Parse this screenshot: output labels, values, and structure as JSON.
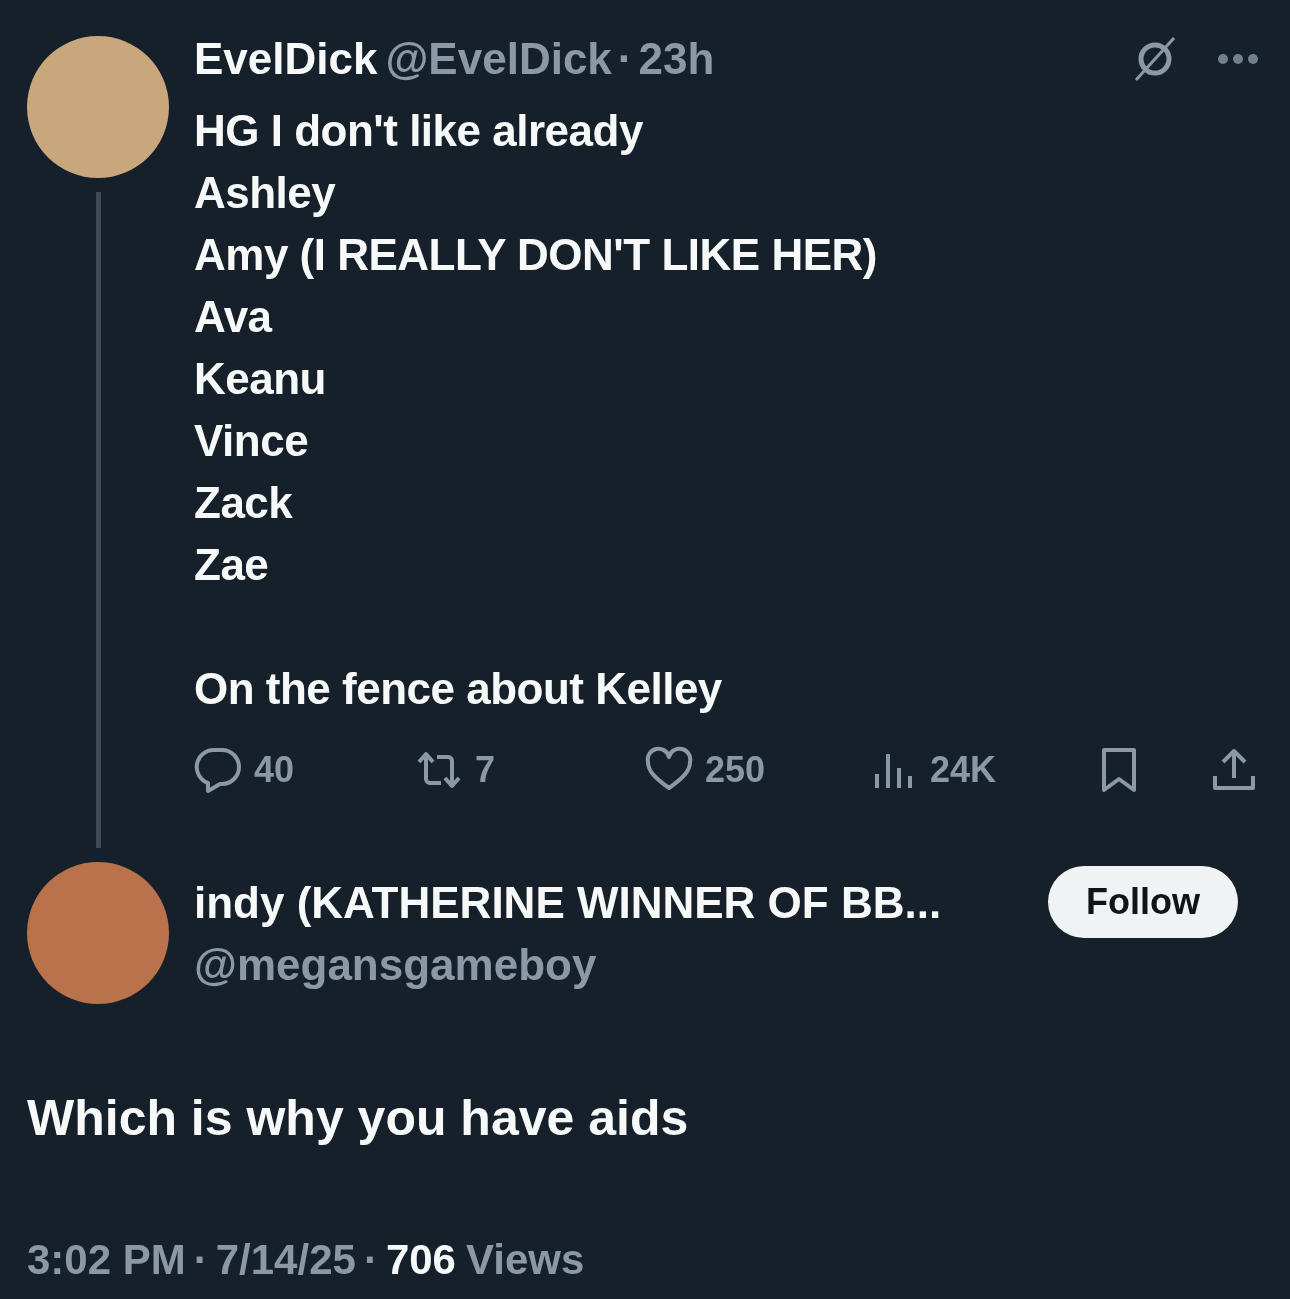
{
  "tweet": {
    "name": "EvelDick",
    "handle": "@EvelDick",
    "separator": "·",
    "time": "23h",
    "paragraphs": [
      "HG I don't like already\nAshley\nAmy (I REALLY DON'T LIKE HER)\nAva\nKeanu\nVince\nZack\nZae",
      "On the fence about Kelley"
    ],
    "actions": [
      {
        "kind": "reply",
        "count": "40"
      },
      {
        "kind": "retweet",
        "count": "7"
      },
      {
        "kind": "like",
        "count": "250"
      },
      {
        "kind": "views",
        "count": "24K"
      },
      {
        "kind": "bookmark"
      },
      {
        "kind": "share"
      }
    ]
  },
  "reply": {
    "name": "indy (KATHERINE WINNER OF BB...",
    "handle": "@megansgameboy",
    "follow_label": "Follow",
    "text": "Which is why you have aids",
    "time": "3:02 PM",
    "separator": "·",
    "date": "7/14/25",
    "views_count": "706",
    "views_label": "Views"
  }
}
